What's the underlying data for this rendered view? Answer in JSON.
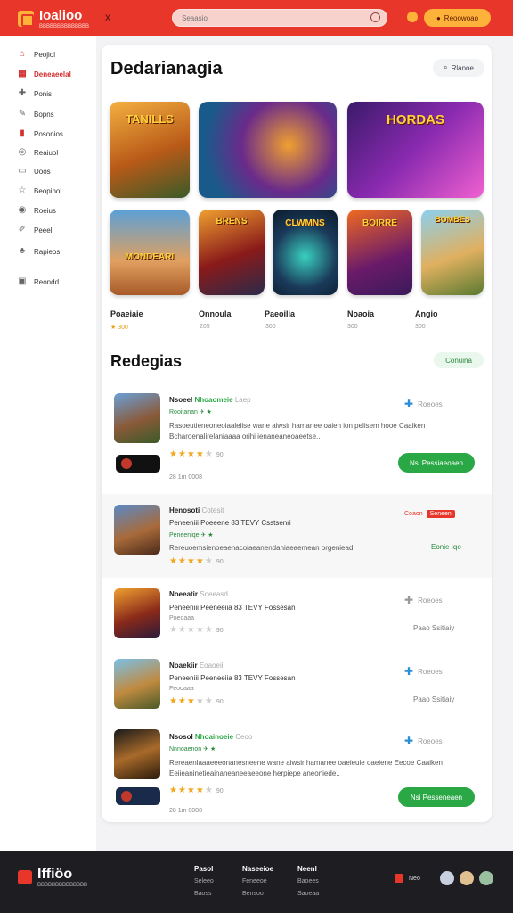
{
  "header": {
    "logo_text": "Ioalioo",
    "logo_sub": "BBBBBBBBBBBBBB",
    "search_placeholder": "Seaasio",
    "top_button": "Reoowoao",
    "close_glyph": "x"
  },
  "sidebar": {
    "items": [
      {
        "label": "Peojiol",
        "icon": "home-icon"
      },
      {
        "label": "Deneaeelal",
        "icon": "grid-icon",
        "active": true
      },
      {
        "label": "Ponis",
        "icon": "puzzle-icon"
      },
      {
        "label": "Bopns",
        "icon": "tools-icon"
      },
      {
        "label": "Posonios",
        "icon": "marker-icon"
      },
      {
        "label": "Reaiuol",
        "icon": "chat-icon"
      },
      {
        "label": "Uoos",
        "icon": "mail-icon"
      },
      {
        "label": "Beopinol",
        "icon": "star-icon"
      },
      {
        "label": "Roeius",
        "icon": "circle-icon"
      },
      {
        "label": "Peeeli",
        "icon": "edit-icon"
      },
      {
        "label": "Rapieos",
        "icon": "user-icon"
      },
      {
        "label": "Reondd",
        "icon": "archive-icon"
      }
    ]
  },
  "featured": {
    "title": "Dedarianagia",
    "browse_label": "Rlanoe",
    "tiles": [
      {
        "caption": "TANILLS"
      },
      {
        "caption": ""
      },
      {
        "caption": "HORDAS"
      },
      {
        "caption": "MONDEARI"
      },
      {
        "caption": "BRENS"
      },
      {
        "caption": "CLWMNS"
      },
      {
        "caption": "BOIRRE"
      },
      {
        "caption": "BOMBES"
      }
    ],
    "names": [
      {
        "name": "Poaeiaie",
        "sub": "★ 300"
      },
      {
        "name": "Onnoula",
        "sub": "205"
      },
      {
        "name": "Paeoilia",
        "sub": "300"
      },
      {
        "name": "Noaoia",
        "sub": "300"
      },
      {
        "name": "Angio",
        "sub": "300"
      }
    ]
  },
  "reviews": {
    "title": "Redegias",
    "filter_label": "Conuina",
    "rows": [
      {
        "title_a": "Nsoeel",
        "title_g": "Nhoaomeie",
        "title_m": "Laep",
        "line": "",
        "sub": "Rooitanan ✈ ★",
        "desc": "Rasoeutieneoneoiaaleiise wane aiwsir hamanee oaien ion pelisem hooe Caaiken Bcharoenalirelaniaaaa orihi ienaneaneoaeetse..",
        "stars": 4,
        "count": "90",
        "meta": "28 1m 0008",
        "right": "Roeoes",
        "button": "Nsi Pessiaeoaen"
      },
      {
        "title_a": "Henosoti",
        "title_g": "",
        "title_m": "Cotesit",
        "line": "Peneeniii Poeeene 83 TEVY Csstsenri",
        "sub": "Peneeniqe ✈ ★",
        "desc": "Rereuoemsienoeaenacoiaeanendaniaeaemean orgeniead",
        "stars": 4,
        "count": "90",
        "meta": "",
        "sale_a": "Coaon",
        "sale_b": "Seneen",
        "right_green": "Eonie Iqo"
      },
      {
        "title_a": "Noeeatir",
        "title_g": "",
        "title_m": "Soeeasd",
        "line": "Peneeniii Peeneeiia 83 TEVY Fossesan",
        "sub": "Poeoaaa",
        "stars": 0,
        "count": "90",
        "right": "Roeoes",
        "right_text": "Paao Ssitiaiy"
      },
      {
        "title_a": "Noaekiir",
        "title_g": "",
        "title_m": "Eoaoeii",
        "line": "Peneeniii Peeneeiia 83 TEVY Fossesan",
        "sub": "Feooaaa",
        "stars": 3,
        "count": "90",
        "right": "Roeoes",
        "right_text": "Paao Ssitiaiy"
      },
      {
        "title_a": "Nsosol",
        "title_g": "Nhoainoeie",
        "title_m": "Ceoo",
        "line": "",
        "sub": "Nnnoaenon ✈ ★",
        "desc": "Rereaenlaaaeeeonanesneene wane aiwsir hamanee oaeieuie oaeiene Eecoe Caaiken Eeiieaninetieainaneaneeaeeone herpiepe aneoniede..",
        "stars": 4,
        "count": "90",
        "meta": "28 1m 0008",
        "right": "Roeoes",
        "button": "Nsi Pesseneaen"
      }
    ]
  },
  "footer": {
    "logo": "Iffiöo",
    "logo_sub": "BBBBBBBBBBBBBB",
    "cols": [
      {
        "head": "Pasol",
        "a": "Seleeo",
        "b": "Baoss"
      },
      {
        "head": "Naseeioe",
        "a": "Feneeoe",
        "b": "Bensoo"
      },
      {
        "head": "Neenl",
        "a": "Baoees",
        "b": "Saoeaa"
      }
    ],
    "right_label": "Neo"
  }
}
